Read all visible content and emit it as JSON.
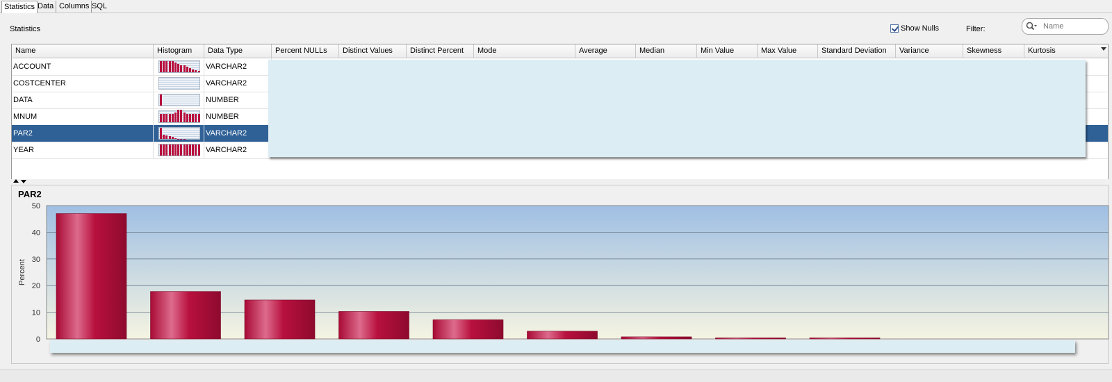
{
  "tabs": [
    {
      "label": "Statistics",
      "active": true
    },
    {
      "label": "Data",
      "active": false
    },
    {
      "label": "Columns",
      "active": false
    },
    {
      "label": "SQL",
      "active": false
    }
  ],
  "header": {
    "section_title": "Statistics",
    "show_nulls_label": "Show Nulls",
    "show_nulls_checked": true,
    "filter_label": "Filter:",
    "filter_placeholder": "Name"
  },
  "table": {
    "columns": [
      "Name",
      "Histogram",
      "Data Type",
      "Percent NULLs",
      "Distinct Values",
      "Distinct Percent",
      "Mode",
      "Average",
      "Median",
      "Min Value",
      "Max Value",
      "Standard Deviation",
      "Variance",
      "Skewness",
      "Kurtosis"
    ],
    "rows": [
      {
        "name": "ACCOUNT",
        "data_type": "VARCHAR2",
        "selected": false
      },
      {
        "name": "COSTCENTER",
        "data_type": "VARCHAR2",
        "selected": false
      },
      {
        "name": "DATA",
        "data_type": "NUMBER",
        "selected": false
      },
      {
        "name": "MNUM",
        "data_type": "NUMBER",
        "selected": false
      },
      {
        "name": "PAR2",
        "data_type": "VARCHAR2",
        "selected": true
      },
      {
        "name": "YEAR",
        "data_type": "VARCHAR2",
        "selected": false
      }
    ],
    "mini_histograms": [
      [
        16,
        16,
        16,
        16,
        16,
        14,
        12,
        10,
        10,
        8,
        6,
        4,
        3,
        2
      ],
      [
        0,
        0,
        0,
        0,
        0,
        0,
        0,
        0,
        0,
        0,
        0,
        0,
        0,
        0
      ],
      [
        16,
        0,
        0,
        0,
        0,
        0,
        0,
        0,
        0,
        0,
        0,
        0,
        0,
        0
      ],
      [
        12,
        12,
        12,
        12,
        12,
        14,
        18,
        18,
        14,
        12,
        12,
        12,
        12,
        12
      ],
      [
        16,
        6,
        5,
        4,
        3,
        1,
        0.5,
        0.3,
        0.3,
        0,
        0,
        0,
        0,
        0
      ],
      [
        16,
        16,
        16,
        16,
        16,
        16,
        16,
        16,
        16,
        16,
        16,
        16,
        16,
        16
      ]
    ]
  },
  "chart_data": {
    "type": "bar",
    "title": "PAR2",
    "ylabel": "Percent",
    "xlabel": "",
    "ylim": [
      0,
      50
    ],
    "yticks": [
      0,
      10,
      20,
      30,
      40,
      50
    ],
    "values": [
      47,
      17.8,
      14.6,
      10.3,
      7.2,
      2.9,
      0.8,
      0.4,
      0.4
    ],
    "bar_color": "#b8103e",
    "grid": true
  },
  "colors": {
    "selected_row": "#2f6197",
    "overlay": "#dcedf4",
    "bar": "#b8103e"
  }
}
